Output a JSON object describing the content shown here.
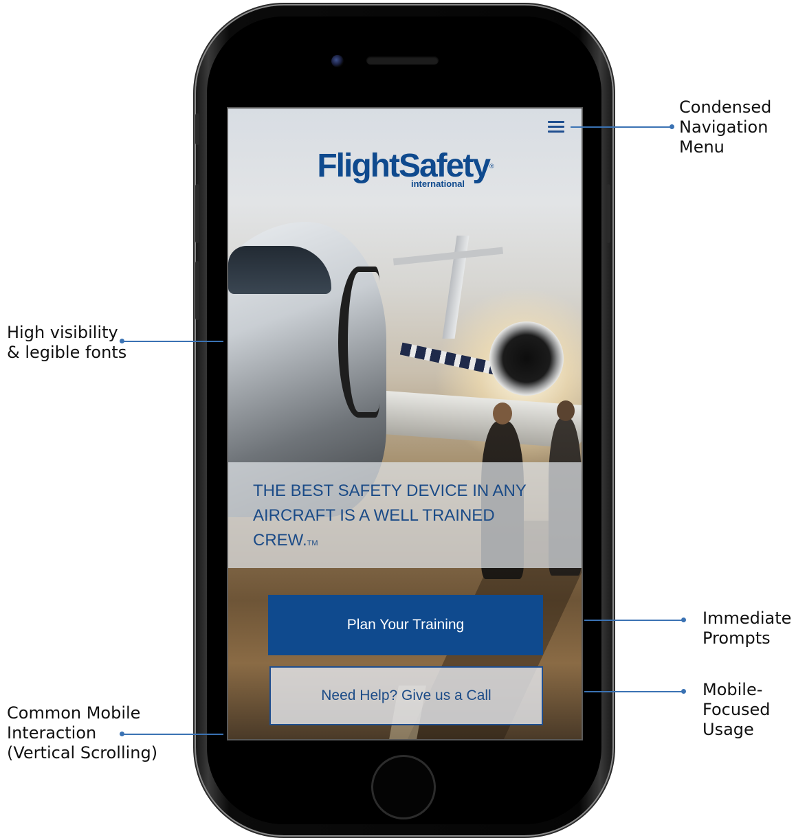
{
  "app": {
    "logo_main": "FlightSafety",
    "logo_sub": "international",
    "logo_reg": "®",
    "tagline": "THE BEST SAFETY DEVICE IN ANY AIRCRAFT IS A WELL TRAINED CREW.",
    "tagline_tm": "TM",
    "primary_button": "Plan Your Training",
    "secondary_button": "Need Help? Give us a Call"
  },
  "annotations": {
    "nav_menu": "Condensed\nNavigation\nMenu",
    "fonts": "High visibility\n& legible fonts",
    "prompts": "Immediate\nPrompts",
    "mobile_usage": "Mobile-\nFocused\nUsage",
    "scrolling": "Common Mobile\nInteraction\n(Vertical Scrolling)"
  },
  "colors": {
    "brand_blue": "#0f4a8e",
    "annotation_line": "#3a72b3"
  },
  "icons": {
    "menu": "hamburger-menu-icon"
  }
}
